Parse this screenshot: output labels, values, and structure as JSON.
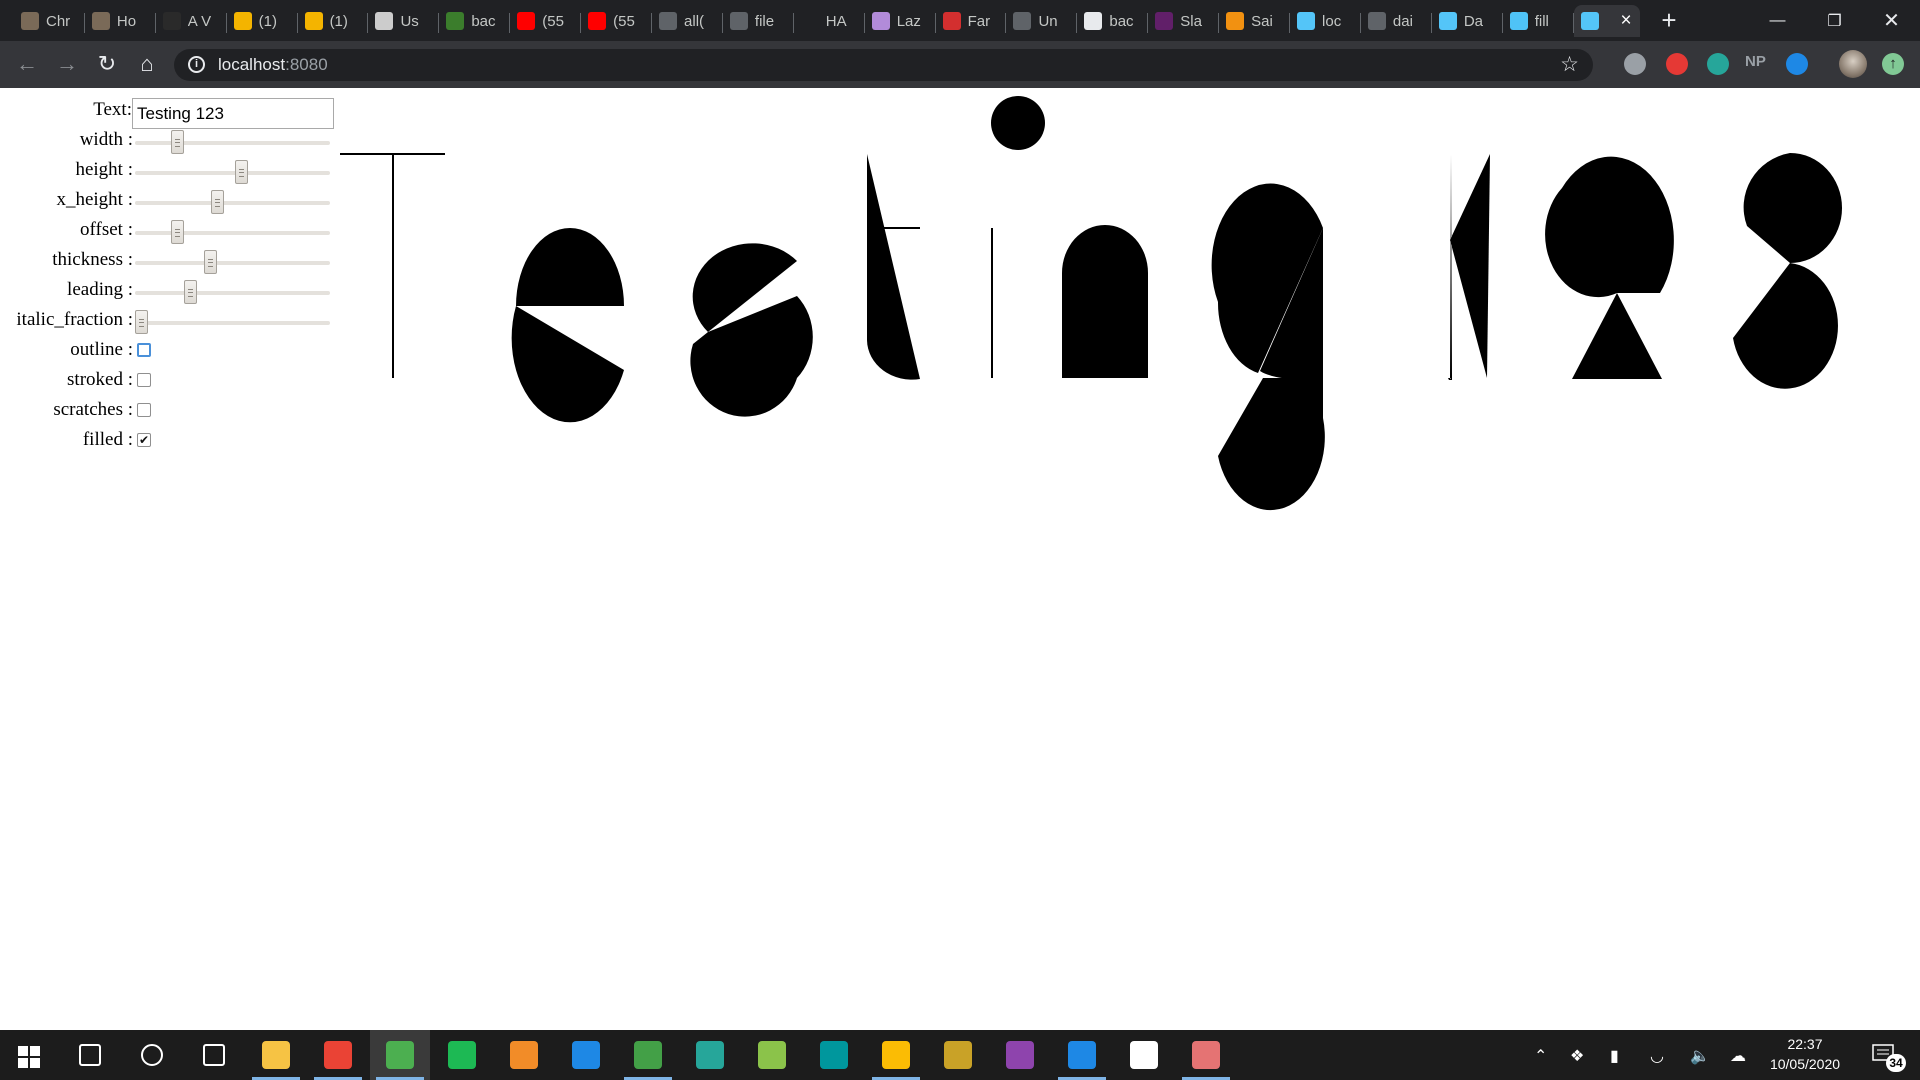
{
  "browser": {
    "tabs": [
      {
        "title": "Chr",
        "icon": "image-icon",
        "color": "#7a6a58"
      },
      {
        "title": "Ho",
        "icon": "image-icon",
        "color": "#7a6a58"
      },
      {
        "title": "A V",
        "icon": "dark-circle-icon",
        "color": "#2a2a2a"
      },
      {
        "title": "(1)",
        "icon": "g-icon",
        "color": "#f4b400"
      },
      {
        "title": "(1)",
        "icon": "g-icon",
        "color": "#f4b400"
      },
      {
        "title": "Us",
        "icon": "logo-icon",
        "color": "#cccccc"
      },
      {
        "title": "bac",
        "icon": "green-bar-icon",
        "color": "#3b7d2c"
      },
      {
        "title": "(55",
        "icon": "youtube-icon",
        "color": "#ff0000"
      },
      {
        "title": "(55",
        "icon": "youtube-icon",
        "color": "#ff0000"
      },
      {
        "title": "all(",
        "icon": "globe-icon",
        "color": "#5f6368"
      },
      {
        "title": "file",
        "icon": "globe-icon",
        "color": "#5f6368"
      },
      {
        "title": "HA",
        "icon": "dots-icon",
        "color": "#202124"
      },
      {
        "title": "Laz",
        "icon": "cursor-icon",
        "color": "#b28bd9"
      },
      {
        "title": "Far",
        "icon": "red-logo-icon",
        "color": "#d32f2f"
      },
      {
        "title": "Un",
        "icon": "globe-icon",
        "color": "#5f6368"
      },
      {
        "title": "bac",
        "icon": "white-logo-icon",
        "color": "#e8eaed"
      },
      {
        "title": "Sla",
        "icon": "slack-icon",
        "color": "#611f69"
      },
      {
        "title": "Sai",
        "icon": "s-icon",
        "color": "#f29111"
      },
      {
        "title": "loc",
        "icon": "flutter-icon",
        "color": "#54c5f8"
      },
      {
        "title": "dai",
        "icon": "globe-icon",
        "color": "#5f6368"
      },
      {
        "title": "Da",
        "icon": "flutter-icon",
        "color": "#54c5f8"
      },
      {
        "title": "fill",
        "icon": "app-icon",
        "color": "#4fc3f7"
      },
      {
        "title": "",
        "icon": "flutter-icon",
        "color": "#54c5f8",
        "active": true
      }
    ],
    "url_host": "localhost",
    "url_port": ":8080",
    "extensions": [
      {
        "icon": "shield-icon",
        "color": "#9aa0a6"
      },
      {
        "icon": "stop-icon",
        "color": "#e53935"
      },
      {
        "icon": "shirt-icon",
        "color": "#26a69a"
      },
      {
        "icon": "np-icon",
        "color": "#9aa0a6",
        "label": "NP"
      },
      {
        "icon": "drop-icon",
        "color": "#1e88e5"
      }
    ]
  },
  "controls": {
    "text_label": "Text:",
    "text_value": "Testing 123",
    "sliders": [
      {
        "key": "width",
        "label": "width :",
        "value": 0.2
      },
      {
        "key": "height",
        "label": "height :",
        "value": 0.55
      },
      {
        "key": "x_height",
        "label": "x_height :",
        "value": 0.42
      },
      {
        "key": "offset",
        "label": "offset :",
        "value": 0.2
      },
      {
        "key": "thickness",
        "label": "thickness :",
        "value": 0.38
      },
      {
        "key": "leading",
        "label": "leading :",
        "value": 0.27
      },
      {
        "key": "italic_fraction",
        "label": "italic_fraction :",
        "value": 0.0
      }
    ],
    "checkboxes": [
      {
        "key": "outline",
        "label": "outline :",
        "checked": false,
        "focused": true
      },
      {
        "key": "stroked",
        "label": "stroked :",
        "checked": false
      },
      {
        "key": "scratches",
        "label": "scratches :",
        "checked": false
      },
      {
        "key": "filled",
        "label": "filled :",
        "checked": true
      }
    ]
  },
  "taskbar": {
    "apps": [
      {
        "name": "search",
        "icon": "search-icon",
        "color": "#1c1c1c"
      },
      {
        "name": "cortana",
        "icon": "circle-icon",
        "color": "#1c1c1c"
      },
      {
        "name": "task-view",
        "icon": "task-view-icon",
        "color": "#1c1c1c"
      },
      {
        "name": "file-explorer",
        "icon": "folder-icon",
        "color": "#f6c344",
        "open": true
      },
      {
        "name": "gmail",
        "icon": "mail-icon",
        "color": "#ea4335",
        "open": true
      },
      {
        "name": "chrome",
        "icon": "chrome-icon",
        "color": "#4caf50",
        "open": true,
        "active": true
      },
      {
        "name": "spotify",
        "icon": "spotify-icon",
        "color": "#1db954"
      },
      {
        "name": "foxit",
        "icon": "f-icon",
        "color": "#f28c28"
      },
      {
        "name": "c-app",
        "icon": "c-icon",
        "color": "#1e88e5"
      },
      {
        "name": "xmind",
        "icon": "x-icon",
        "color": "#43a047",
        "open": true
      },
      {
        "name": "terminal",
        "icon": "terminal-icon",
        "color": "#26a69a"
      },
      {
        "name": "image-app",
        "icon": "photo-icon",
        "color": "#8bc34a"
      },
      {
        "name": "arduino",
        "icon": "infinity-icon",
        "color": "#00979d"
      },
      {
        "name": "keep",
        "icon": "bulb-icon",
        "color": "#fbbc04",
        "open": true
      },
      {
        "name": "globe-app",
        "icon": "globe-icon",
        "color": "#c9a227"
      },
      {
        "name": "visual-studio",
        "icon": "vs-icon",
        "color": "#8e44ad"
      },
      {
        "name": "vscode",
        "icon": "vscode-icon",
        "color": "#1e88e5",
        "open": true
      },
      {
        "name": "fontforge",
        "icon": "ff-icon",
        "color": "#ffffff"
      },
      {
        "name": "paint",
        "icon": "paint-icon",
        "color": "#e57373",
        "open": true
      }
    ],
    "time": "22:37",
    "date": "10/05/2020",
    "notification_count": "34"
  }
}
